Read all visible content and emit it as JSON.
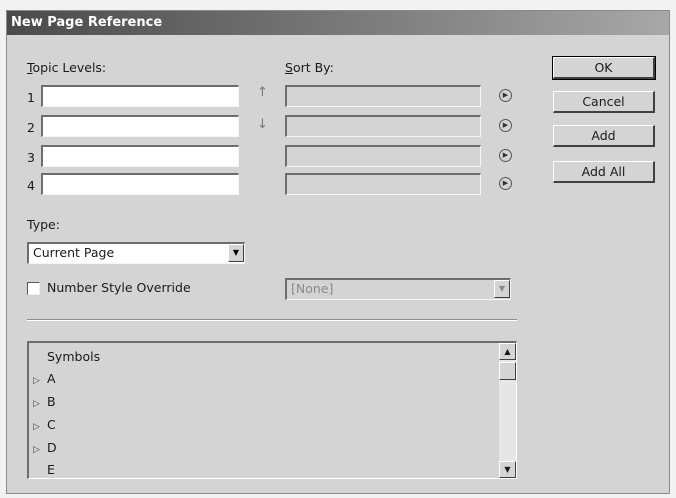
{
  "dialog": {
    "title": "New Page Reference"
  },
  "topic_levels": {
    "label": "Topic Levels:",
    "rows": [
      {
        "num": "1",
        "value": ""
      },
      {
        "num": "2",
        "value": ""
      },
      {
        "num": "3",
        "value": ""
      },
      {
        "num": "4",
        "value": ""
      }
    ]
  },
  "sort_by": {
    "label": "Sort By:",
    "values": [
      "",
      "",
      "",
      ""
    ]
  },
  "buttons": {
    "ok": "OK",
    "cancel": "Cancel",
    "add": "Add",
    "add_all": "Add All"
  },
  "type": {
    "label": "Type:",
    "selected": "Current Page"
  },
  "number_style_override": {
    "label": "Number Style Override",
    "checked": false,
    "selected": "[None]"
  },
  "topics_list": {
    "items": [
      {
        "label": "Symbols",
        "expandable": false
      },
      {
        "label": "A",
        "expandable": true
      },
      {
        "label": "B",
        "expandable": true
      },
      {
        "label": "C",
        "expandable": true
      },
      {
        "label": "D",
        "expandable": true
      },
      {
        "label": "E",
        "expandable": false
      }
    ]
  },
  "icons": {
    "move_up": "up-arrow-icon",
    "move_down": "down-arrow-icon",
    "cycle": "circle-arrow-icon",
    "dropdown": "dropdown-arrow-icon",
    "expand": "expand-triangle-icon"
  }
}
